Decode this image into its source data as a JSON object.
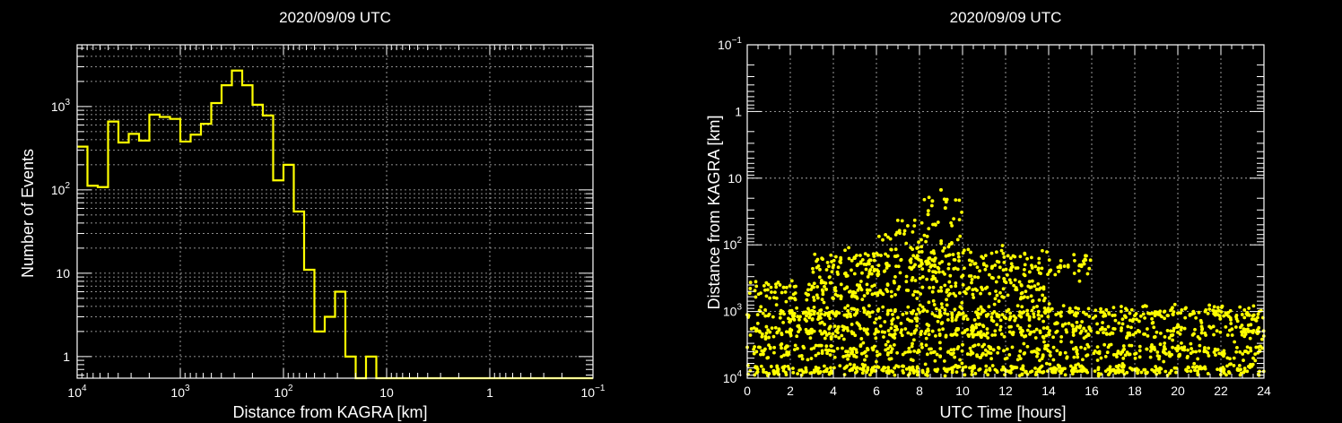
{
  "colors": {
    "background": "#000000",
    "foreground": "#ffffff",
    "series": "#ffff00",
    "grid": "#bdbdbd"
  },
  "chart_data": [
    {
      "type": "histogram",
      "title": "2020/09/09 UTC",
      "xlabel": "Distance from KAGRA [km]",
      "ylabel": "Number of Events",
      "x_scale": "log",
      "y_scale": "log",
      "x_reversed": true,
      "xlim": [
        10000,
        0.1
      ],
      "ylim": [
        0.55,
        5500
      ],
      "grid": true,
      "x_tick_labels": [
        {
          "value": 10000,
          "base": "10",
          "exp": "4"
        },
        {
          "value": 1000,
          "base": "10",
          "exp": "3"
        },
        {
          "value": 100,
          "base": "10",
          "exp": "2"
        },
        {
          "value": 10,
          "base": "10",
          "exp": ""
        },
        {
          "value": 1,
          "base": "1",
          "exp": ""
        },
        {
          "value": 0.1,
          "base": "10",
          "exp": "−1"
        }
      ],
      "y_tick_labels": [
        {
          "value": 1000,
          "base": "10",
          "exp": "3"
        },
        {
          "value": 100,
          "base": "10",
          "exp": "2"
        },
        {
          "value": 10,
          "base": "10",
          "exp": ""
        },
        {
          "value": 1,
          "base": "1",
          "exp": ""
        }
      ],
      "bins_log10_distance": [
        4.0,
        3.9,
        3.8,
        3.7,
        3.6,
        3.5,
        3.4,
        3.3,
        3.2,
        3.1,
        3.0,
        2.9,
        2.8,
        2.7,
        2.6,
        2.5,
        2.4,
        2.3,
        2.2,
        2.1,
        2.0,
        1.9,
        1.8,
        1.7,
        1.6,
        1.5,
        1.4,
        1.3,
        1.2,
        1.1,
        1.0
      ],
      "counts": [
        330,
        112,
        108,
        660,
        370,
        470,
        390,
        800,
        750,
        710,
        380,
        460,
        620,
        1100,
        1800,
        2700,
        1800,
        1050,
        780,
        130,
        200,
        55,
        11,
        2,
        3,
        6,
        1,
        0,
        1,
        0
      ]
    },
    {
      "type": "scatter",
      "title": "2020/09/09 UTC",
      "xlabel": "UTC Time [hours]",
      "ylabel": "Distance from KAGRA [km]",
      "x_scale": "linear",
      "y_scale": "log",
      "y_reversed": true,
      "xlim": [
        0,
        24
      ],
      "ylim": [
        0.1,
        10000
      ],
      "grid": true,
      "x_ticks": [
        "0",
        "2",
        "4",
        "6",
        "8",
        "10",
        "12",
        "14",
        "16",
        "18",
        "20",
        "22",
        "24"
      ],
      "y_tick_labels": [
        {
          "value": 0.1,
          "base": "10",
          "exp": "−1"
        },
        {
          "value": 1,
          "base": "1",
          "exp": ""
        },
        {
          "value": 10,
          "base": "10",
          "exp": ""
        },
        {
          "value": 100,
          "base": "10",
          "exp": "2"
        },
        {
          "value": 1000,
          "base": "10",
          "exp": "3"
        },
        {
          "value": 10000,
          "base": "10",
          "exp": "4"
        }
      ],
      "point_bands": [
        {
          "x_range": [
            0,
            24
          ],
          "distance_km": 7500,
          "spread_dex": 0.05,
          "density": 1.0
        },
        {
          "x_range": [
            0,
            24
          ],
          "distance_km": 4000,
          "spread_dex": 0.08,
          "density": 0.9
        },
        {
          "x_range": [
            0,
            24
          ],
          "distance_km": 2000,
          "spread_dex": 0.07,
          "density": 0.9
        },
        {
          "x_range": [
            0,
            24
          ],
          "distance_km": 1100,
          "spread_dex": 0.08,
          "density": 1.0
        },
        {
          "x_range": [
            0,
            14
          ],
          "distance_km": 500,
          "spread_dex": 0.1,
          "density": 0.9
        },
        {
          "x_range": [
            3,
            16
          ],
          "distance_km": 200,
          "spread_dex": 0.15,
          "density": 1.2
        },
        {
          "x_range": [
            6,
            10
          ],
          "distance_km": 80,
          "spread_dex": 0.2,
          "density": 0.8
        },
        {
          "x_range": [
            8,
            10
          ],
          "distance_km": 30,
          "spread_dex": 0.25,
          "density": 0.4
        }
      ],
      "isolated_points": [
        {
          "x": 9.0,
          "distance_km": 15
        },
        {
          "x": 8.6,
          "distance_km": 22
        },
        {
          "x": 9.2,
          "distance_km": 28
        },
        {
          "x": 8.4,
          "distance_km": 35
        }
      ]
    }
  ]
}
